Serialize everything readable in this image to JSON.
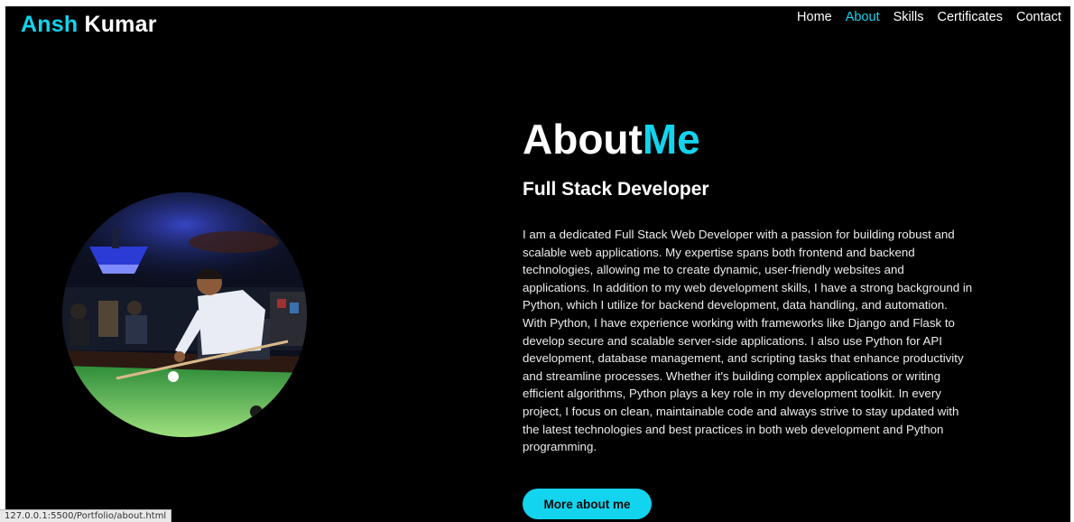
{
  "brand": {
    "first": "Ansh",
    "last": " Kumar"
  },
  "nav": {
    "items": [
      {
        "label": "Home",
        "active": false
      },
      {
        "label": "About",
        "active": true
      },
      {
        "label": "Skills",
        "active": false
      },
      {
        "label": "Certificates",
        "active": false
      },
      {
        "label": "Contact",
        "active": false
      }
    ]
  },
  "about": {
    "title_part1": "About",
    "title_part2": "Me",
    "subtitle": "Full Stack Developer",
    "paragraph1": "I am a dedicated Full Stack Web Developer with a passion for building robust and scalable web applications. My expertise spans both frontend and backend technologies, allowing me to create dynamic, user-friendly websites and applications. In addition to my web development skills, I have a strong background in Python, which I utilize for backend development, data handling, and automation.",
    "paragraph2": "With Python, I have experience working with frameworks like Django and Flask to develop secure and scalable server-side applications. I also use Python for API development, database management, and scripting tasks that enhance productivity and streamline processes. Whether it's building complex applications or writing efficient algorithms, Python plays a key role in my development toolkit. In every project, I focus on clean, maintainable code and always strive to stay updated with the latest technologies and best practices in both web development and Python programming.",
    "button_label": "More about me"
  },
  "status_bar": {
    "url": "127.0.0.1:5500/Portfolio/about.html"
  },
  "colors": {
    "accent": "#12d4ee",
    "background": "#000000",
    "text": "#ffffff"
  }
}
